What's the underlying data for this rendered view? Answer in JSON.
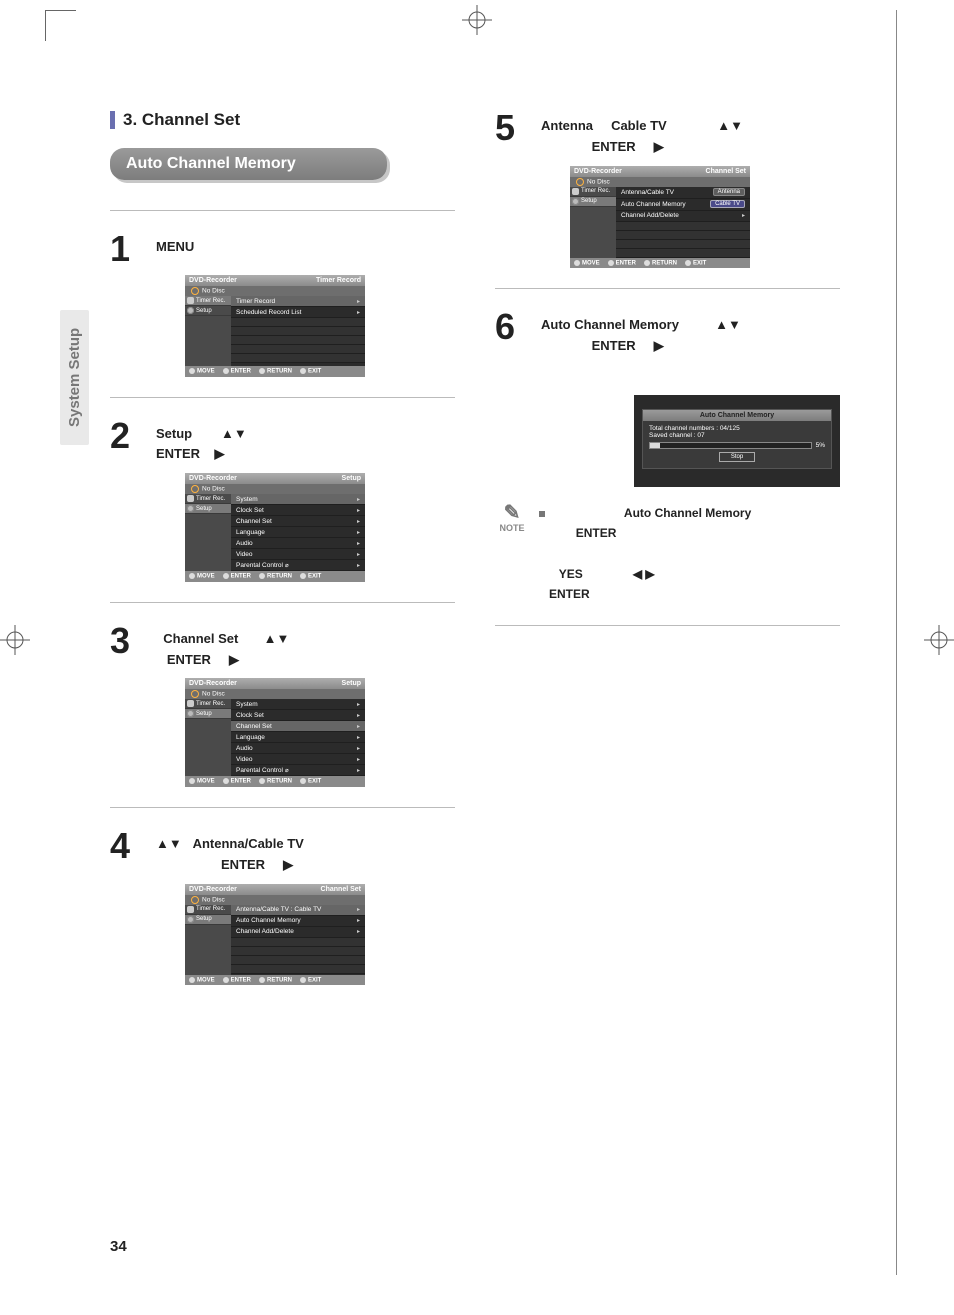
{
  "page_number": "34",
  "side_tab": "System Setup",
  "section": {
    "number_title": "3. Channel Set"
  },
  "pill": {
    "title": "Auto Channel Memory"
  },
  "step1": {
    "num": "1",
    "text": "MENU"
  },
  "step2": {
    "num": "2",
    "a": "Setup",
    "b": "ENTER"
  },
  "step3": {
    "num": "3",
    "a": "Channel Set",
    "b": "ENTER"
  },
  "step4": {
    "num": "4",
    "a": "Antenna/Cable TV",
    "b": "ENTER"
  },
  "step5": {
    "num": "5",
    "a": "Antenna",
    "b": "Cable TV",
    "c": "ENTER"
  },
  "step6": {
    "num": "6",
    "a": "Auto Channel Memory",
    "b": "ENTER"
  },
  "glyphs": {
    "updown": "▲▼",
    "right": "▶",
    "leftright": "◀ ▶"
  },
  "osd_common": {
    "device": "DVD-Recorder",
    "no_disc": "No Disc",
    "side_timer": "Timer Rec.",
    "side_setup": "Setup",
    "foot_move": "MOVE",
    "foot_enter": "ENTER",
    "foot_return": "RETURN",
    "foot_exit": "EXIT"
  },
  "osd1": {
    "crumb": "Timer Record",
    "items": [
      "Timer Record",
      "Scheduled Record List"
    ]
  },
  "osd2": {
    "crumb": "Setup",
    "items": [
      "System",
      "Clock Set",
      "Channel Set",
      "Language",
      "Audio",
      "Video",
      "Parental Control"
    ],
    "highlight": 0
  },
  "osd3": {
    "crumb": "Setup",
    "items": [
      "System",
      "Clock Set",
      "Channel Set",
      "Language",
      "Audio",
      "Video",
      "Parental Control"
    ],
    "highlight": 2
  },
  "osd4": {
    "crumb": "Channel Set",
    "items": [
      "Antenna/Cable TV  :  Cable TV",
      "Auto Channel Memory",
      "Channel Add/Delete"
    ],
    "highlight": 0
  },
  "osd5": {
    "crumb": "Channel Set",
    "items": [
      "Antenna/Cable TV",
      "Auto Channel Memory",
      "Channel Add/Delete"
    ],
    "options": [
      "Antenna",
      "Cable TV"
    ],
    "selected_option": 1
  },
  "osd6": {
    "title": "Auto Channel Memory",
    "line1": "Total channel numbers :  04/125",
    "line2": "Saved channel : 07",
    "percent": "5%",
    "stop": "Stop"
  },
  "note": {
    "label": "NOTE",
    "term1": "Auto Channel Memory",
    "enter": "ENTER",
    "yes": "YES",
    "enter2": "ENTER"
  }
}
